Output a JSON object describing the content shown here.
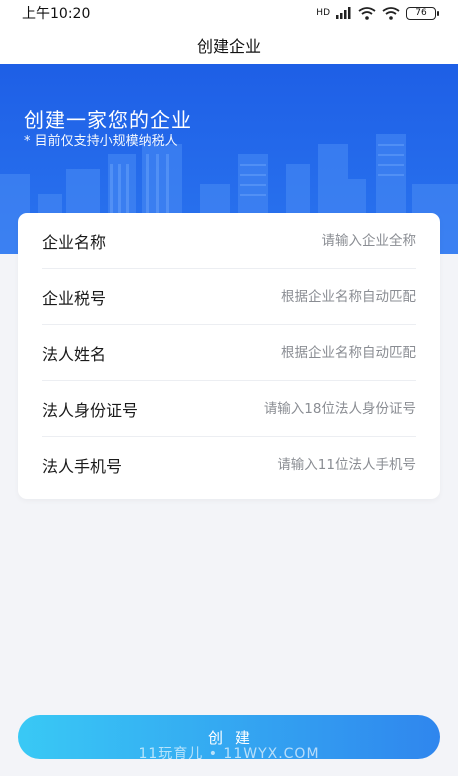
{
  "status": {
    "time": "上午10:20",
    "hd": "HD",
    "battery": "76"
  },
  "nav": {
    "title": "创建企业"
  },
  "hero": {
    "title": "创建一家您的企业",
    "subtitle": "* 目前仅支持小规模纳税人"
  },
  "form": {
    "rows": [
      {
        "label": "企业名称",
        "placeholder": "请输入企业全称"
      },
      {
        "label": "企业税号",
        "placeholder": "根据企业名称自动匹配"
      },
      {
        "label": "法人姓名",
        "placeholder": "根据企业名称自动匹配"
      },
      {
        "label": "法人身份证号",
        "placeholder": "请输入18位法人身份证号"
      },
      {
        "label": "法人手机号",
        "placeholder": "请输入11位法人手机号"
      }
    ]
  },
  "actions": {
    "create_label": "创建"
  },
  "watermark": "11玩育儿 • 11WYX.COM",
  "colors": {
    "hero_blue": "#1e5fe6",
    "button_start": "#39c9f5",
    "button_end": "#2f86ee"
  }
}
